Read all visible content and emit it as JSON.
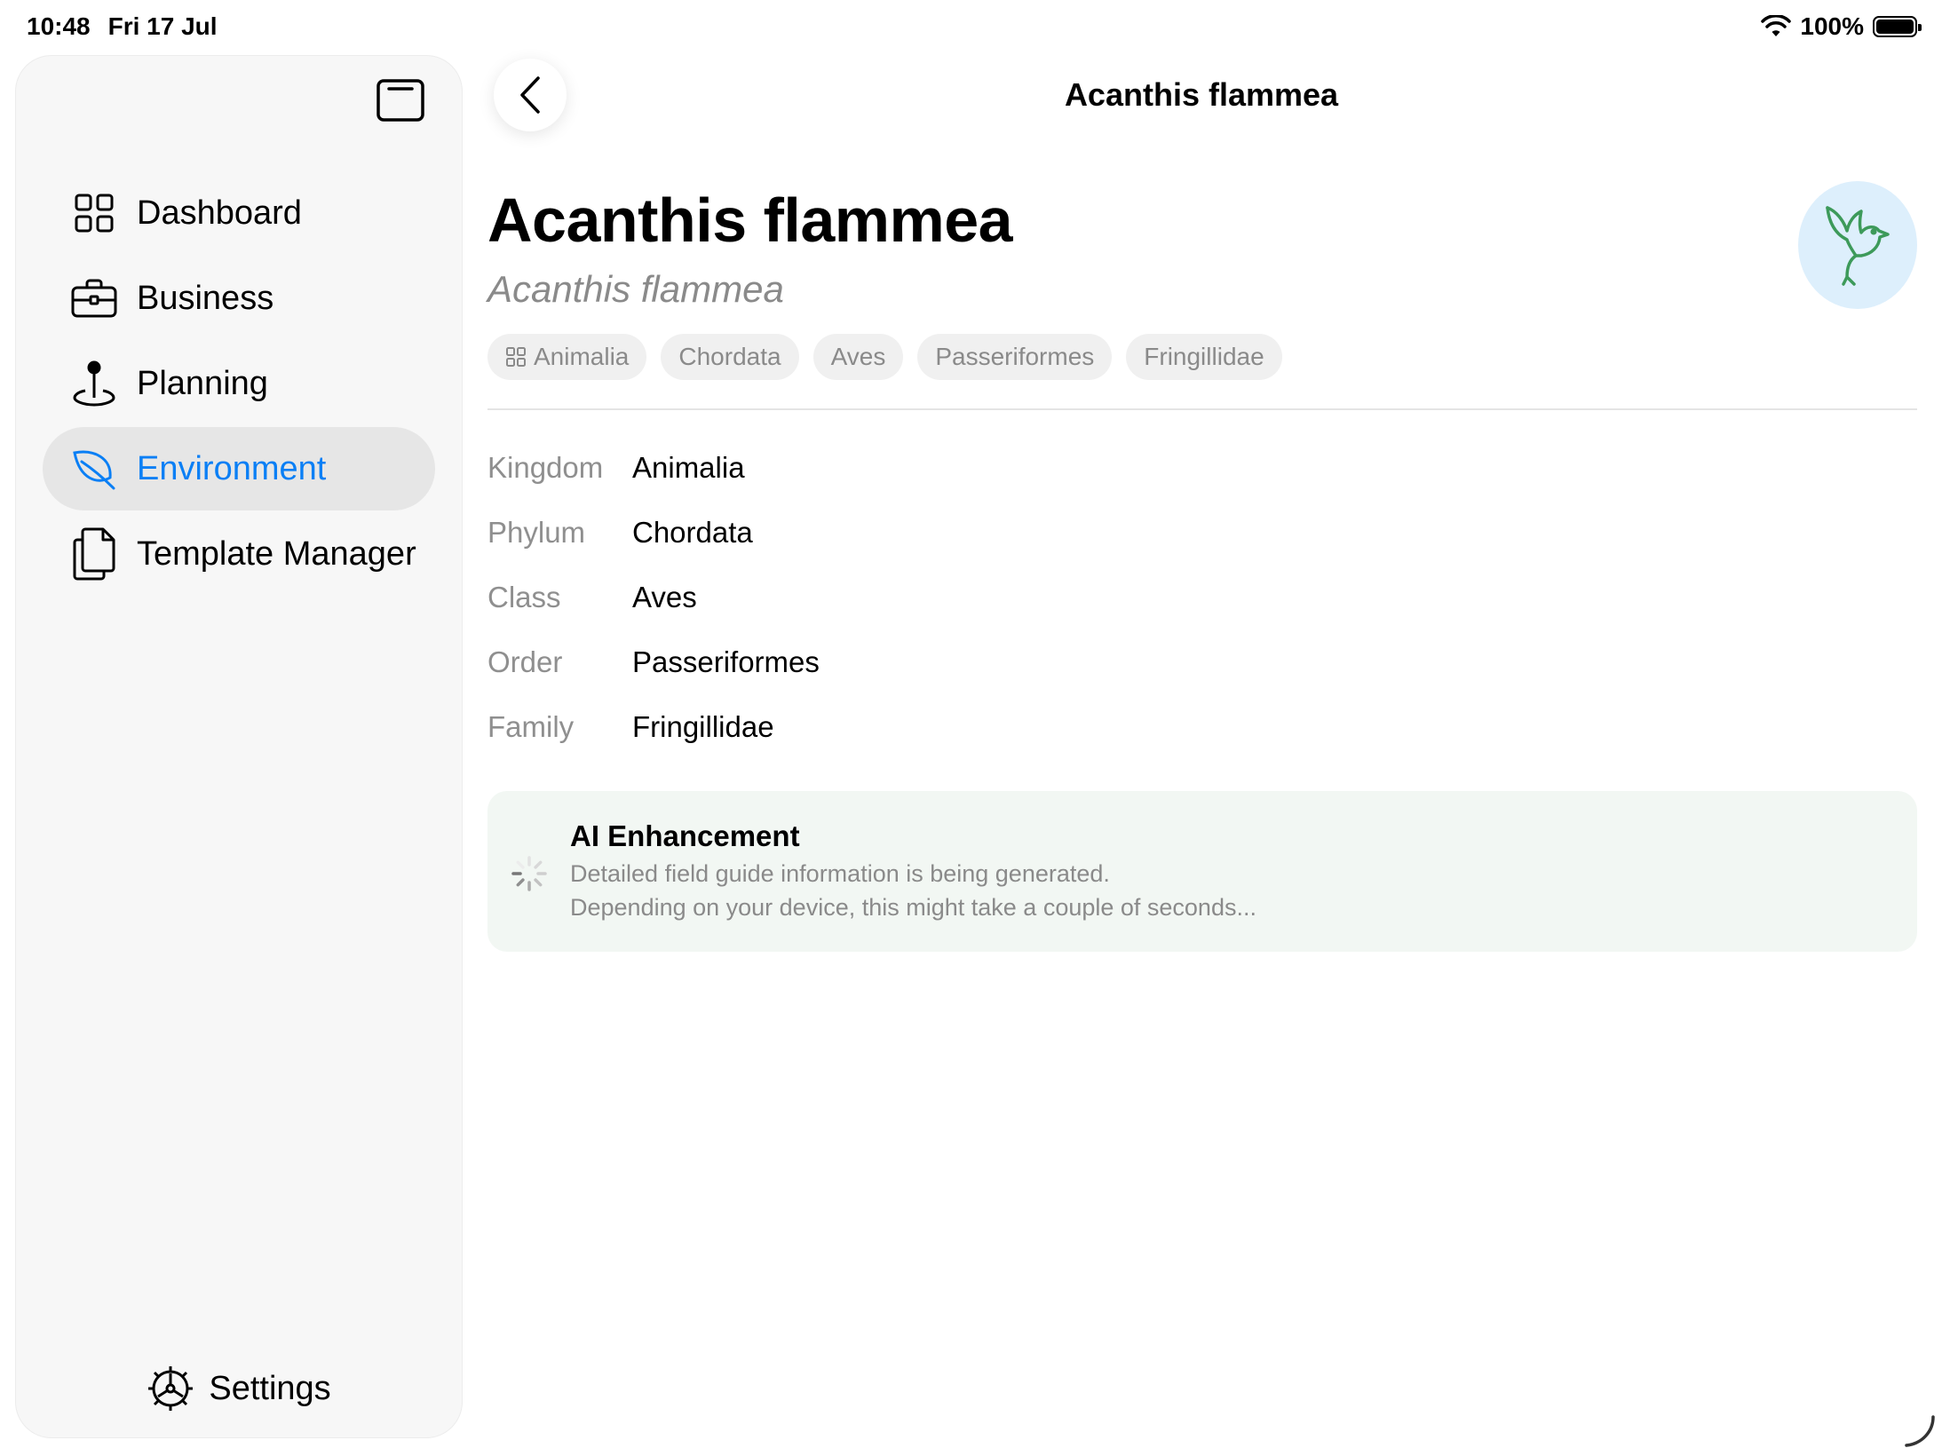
{
  "status_bar": {
    "time": "10:48",
    "date": "Fri 17 Jul",
    "battery": "100%"
  },
  "sidebar": {
    "items": [
      {
        "label": "Dashboard",
        "icon": "grid-icon"
      },
      {
        "label": "Business",
        "icon": "briefcase-icon"
      },
      {
        "label": "Planning",
        "icon": "map-pin-icon"
      },
      {
        "label": "Environment",
        "icon": "leaf-icon",
        "active": true
      },
      {
        "label": "Template Manager",
        "icon": "documents-icon"
      }
    ],
    "settings_label": "Settings"
  },
  "header": {
    "title": "Acanthis flammea"
  },
  "species": {
    "name": "Acanthis flammea",
    "scientific_name": "Acanthis flammea",
    "avatar_icon": "bird-icon",
    "chips": [
      "Animalia",
      "Chordata",
      "Aves",
      "Passeriformes",
      "Fringillidae"
    ],
    "taxonomy": [
      {
        "label": "Kingdom",
        "value": "Animalia"
      },
      {
        "label": "Phylum",
        "value": "Chordata"
      },
      {
        "label": "Class",
        "value": "Aves"
      },
      {
        "label": "Order",
        "value": "Passeriformes"
      },
      {
        "label": "Family",
        "value": "Fringillidae"
      }
    ]
  },
  "ai_card": {
    "title": "AI Enhancement",
    "line1": "Detailed field guide information is being generated.",
    "line2": "Depending on your device, this might take a couple of seconds..."
  },
  "colors": {
    "accent": "#0a7ff5",
    "avatar_bg": "#ddeffc",
    "bird_green": "#3d9a5a",
    "card_bg": "#f2f7f3"
  }
}
